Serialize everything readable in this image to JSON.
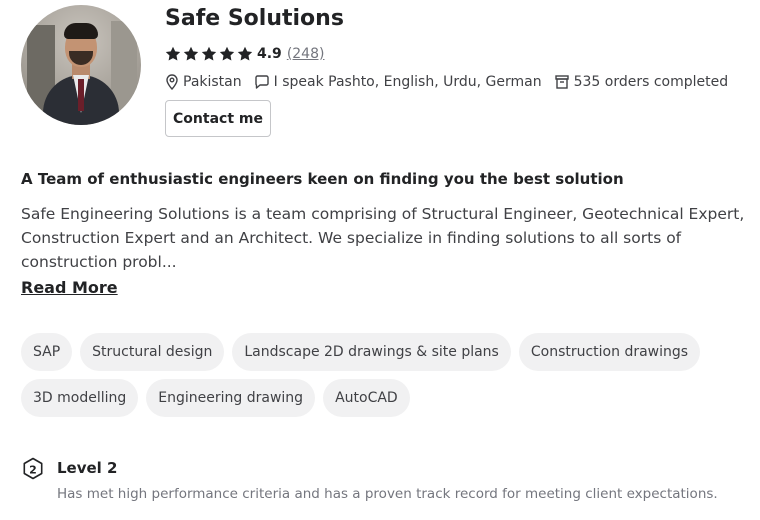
{
  "profile": {
    "name": "Safe Solutions",
    "rating_value": "4.9",
    "rating_count": "(248)",
    "stars": 5,
    "location": "Pakistan",
    "languages": "I speak Pashto, English, Urdu, German",
    "orders": "535 orders completed",
    "contact_label": "Contact me"
  },
  "about": {
    "headline": "A Team of enthusiastic engineers keen on finding you the best solution",
    "description": "Safe Engineering Solutions is a team comprising of Structural Engineer, Geotechnical Expert, Construction Expert and an Architect. We specialize in finding solutions to all sorts of construction probl...",
    "read_more": "Read More"
  },
  "skills": [
    "SAP",
    "Structural design",
    "Landscape 2D drawings & site plans",
    "Construction drawings",
    "3D modelling",
    "Engineering drawing",
    "AutoCAD"
  ],
  "level": {
    "badge": "2",
    "title": "Level 2",
    "description": "Has met high performance criteria and has a proven track record for meeting client expectations."
  },
  "colors": {
    "text_primary": "#222325",
    "text_secondary": "#74767e",
    "tag_bg": "#f1f1f2",
    "star": "#222325"
  },
  "icons": {
    "location": "location-pin-icon",
    "language": "speech-bubble-icon",
    "orders": "box-icon",
    "star": "star-icon",
    "level": "level-badge-icon"
  }
}
